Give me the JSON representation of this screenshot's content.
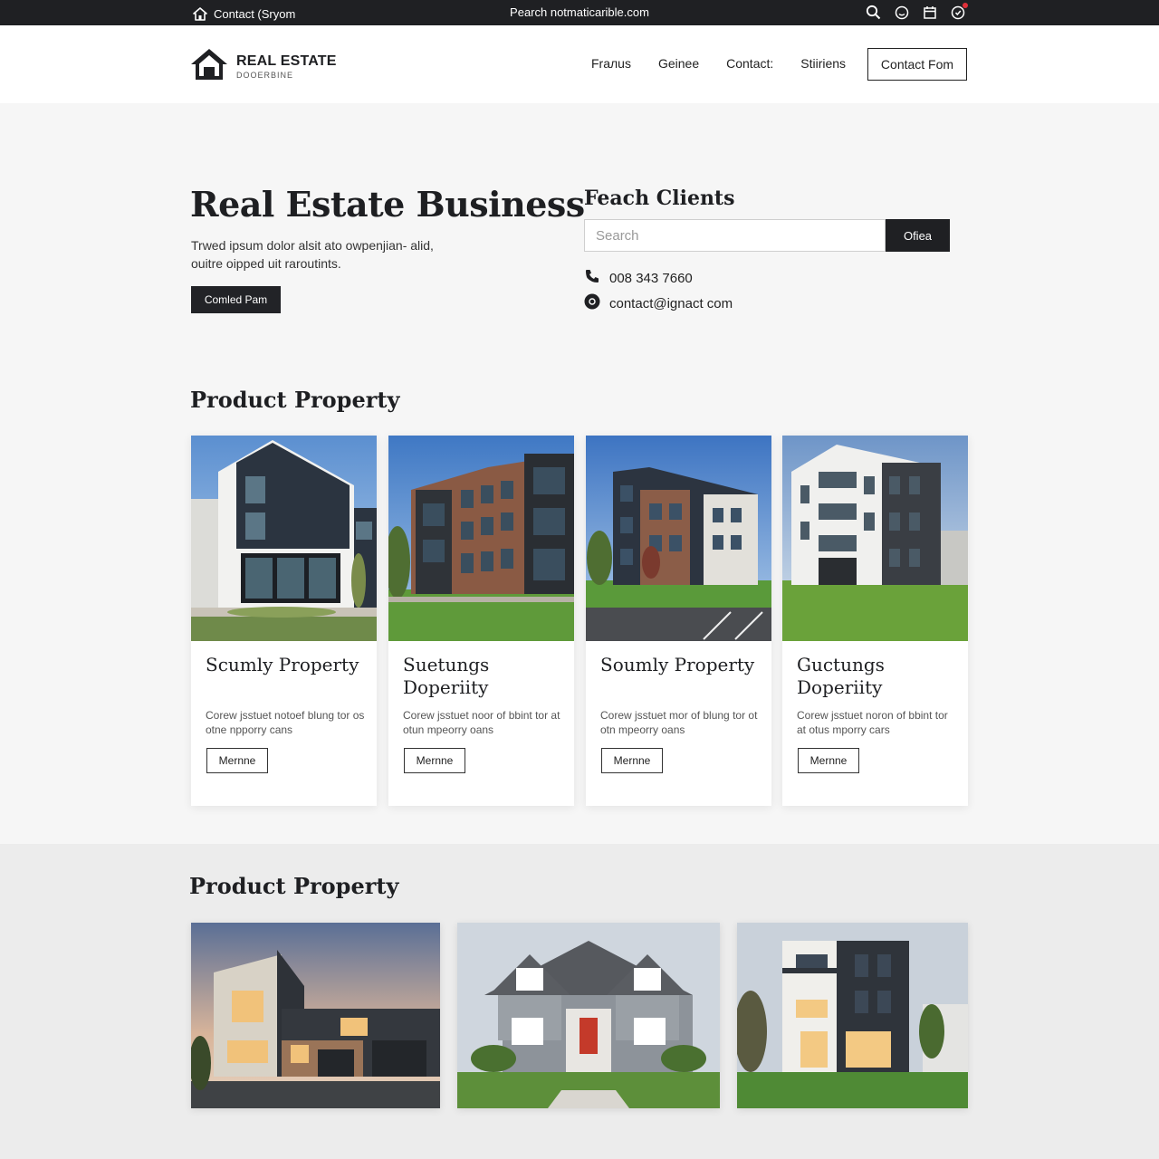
{
  "topbar": {
    "left_label": "Contact (Sryom",
    "center_text": "Pearch notmaticarible.com",
    "icons": [
      "search-icon",
      "smiley-icon",
      "calendar-icon",
      "notification-icon"
    ]
  },
  "brand": {
    "title": "REAL ESTATE",
    "subtitle": "DOOERBINE"
  },
  "nav": {
    "items": [
      "Frалus",
      "Geinee",
      "Contact:",
      "Stiiriens"
    ],
    "contact_button": "Contact Fom"
  },
  "hero": {
    "title": "Real Estate Business",
    "text": "Trwed ipsum dolor alsit ato owpenjian- alid, ouitre oipped uit raroutints.",
    "button": "Comled Pam"
  },
  "clients": {
    "title": "Feach Clients",
    "search_placeholder": "Search",
    "search_button": "Ofiea",
    "phone": "008 343 7660",
    "email": "contact@ignact com"
  },
  "products": {
    "title": "Product Property",
    "cards": [
      {
        "title": "Scumly Property",
        "desc": "Corew jsstuet notoef blung tor os otne npporry cans",
        "button": "Mernne"
      },
      {
        "title": "Suetungs Doperiity",
        "desc": "Corew jsstuet noor of bbint tor at otun mpeorry oans",
        "button": "Mernne"
      },
      {
        "title": "Soumly Property",
        "desc": "Corew jsstuet mor of blung tor ot otn mpeorry oans",
        "button": "Mernne"
      },
      {
        "title": "Guctungs Doperiity",
        "desc": "Corew jsstuet noron of bbint tor at otus mporry cars",
        "button": "Mernne"
      }
    ]
  },
  "products2": {
    "title": "Product Property"
  },
  "colors": {
    "dark": "#1f2023",
    "accent_red": "#e0303a",
    "sky": "#5a8cc8",
    "lawn": "#5f9a3a"
  }
}
